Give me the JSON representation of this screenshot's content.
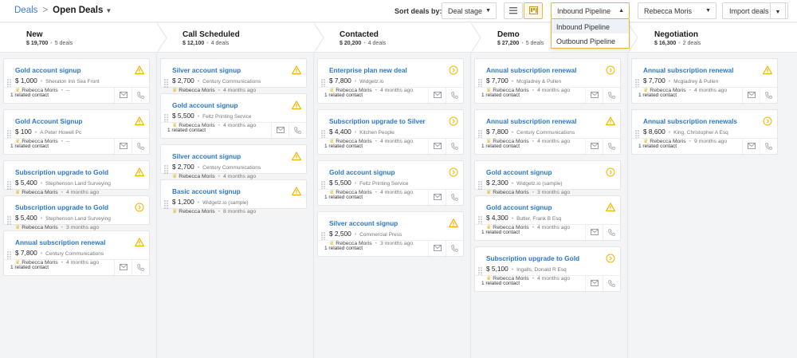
{
  "breadcrumb": {
    "root": "Deals",
    "separator": ">",
    "current": "Open Deals"
  },
  "toolbar": {
    "sort_label": "Sort deals by:",
    "sort_value": "Deal stage",
    "pipeline_value": "Inbound Pipeline",
    "pipeline_options": [
      "Inbound Pipeline",
      "Outbound Pipeline"
    ],
    "owner_value": "Rebecca Moris",
    "import_label": "Import deals"
  },
  "stages": [
    {
      "name": "New",
      "amount": "$ 19,700",
      "count": "5 deals"
    },
    {
      "name": "Call Scheduled",
      "amount": "$ 12,100",
      "count": "4 deals"
    },
    {
      "name": "Contacted",
      "amount": "$ 20,200",
      "count": "4 deals"
    },
    {
      "name": "Demo",
      "amount": "$ 27,200",
      "count": "5 deals"
    },
    {
      "name": "Negotiation",
      "amount": "$ 16,300",
      "count": "2 deals"
    }
  ],
  "related_label": "1 related contact",
  "columns": [
    {
      "cards": [
        {
          "title": "Gold account signup",
          "value": "$ 1,000",
          "org": "Sheraton Inn Sea Front",
          "owner": "Rebecca Moris",
          "ago": "--",
          "status": "warn",
          "footer": true
        },
        {
          "title": "Gold Account Signup",
          "value": "$ 100",
          "org": "A Peter Howell Pc",
          "owner": "Rebecca Moris",
          "ago": "--",
          "status": "warn",
          "footer": true
        },
        {
          "title": "Subscription upgrade to Gold",
          "value": "$ 5,400",
          "org": "Stephenson Land Surveying",
          "owner": "Rebecca Moris",
          "ago": "4 months ago",
          "status": "warn",
          "footer": false
        },
        {
          "title": "Subscription upgrade to Gold",
          "value": "$ 5,400",
          "org": "Stephenson Land Surveying",
          "owner": "Rebecca Moris",
          "ago": "3 months ago",
          "status": "next",
          "footer": false
        },
        {
          "title": "Annual subscription renewal",
          "value": "$ 7,800",
          "org": "Century Communications",
          "owner": "Rebecca Moris",
          "ago": "4 months ago",
          "status": "warn",
          "footer": true
        }
      ]
    },
    {
      "cards": [
        {
          "title": "Silver account signup",
          "value": "$ 2,700",
          "org": "Century Communications",
          "owner": "Rebecca Moris",
          "ago": "4 months ago",
          "status": "warn",
          "footer": false
        },
        {
          "title": "Gold account signup",
          "value": "$ 5,500",
          "org": "Feltz Printing Service",
          "owner": "Rebecca Moris",
          "ago": "4 months ago",
          "status": "warn",
          "footer": true
        },
        {
          "title": "Silver account signup",
          "value": "$ 2,700",
          "org": "Century Communications",
          "owner": "Rebecca Moris",
          "ago": "4 months ago",
          "status": "warn",
          "footer": false
        },
        {
          "title": "Basic account signup",
          "value": "$ 1,200",
          "org": "Widgetz.io (sample)",
          "owner": "Rebecca Moris",
          "ago": "8 months ago",
          "status": "warn",
          "footer": false
        }
      ]
    },
    {
      "cards": [
        {
          "title": "Enterprise plan new deal",
          "value": "$ 7,800",
          "org": "Widgetz.io",
          "owner": "Rebecca Moris",
          "ago": "4 months ago",
          "status": "next",
          "footer": true
        },
        {
          "title": "Subscription upgrade to Silver",
          "value": "$ 4,400",
          "org": "Kitchen People",
          "owner": "Rebecca Moris",
          "ago": "4 months ago",
          "status": "next",
          "footer": true
        },
        {
          "title": "Gold account signup",
          "value": "$ 5,500",
          "org": "Feltz Printing Service",
          "owner": "Rebecca Moris",
          "ago": "4 months ago",
          "status": "next",
          "footer": true
        },
        {
          "title": "Silver account signup",
          "value": "$ 2,500",
          "org": "Commercial Press",
          "owner": "Rebecca Moris",
          "ago": "3 months ago",
          "status": "warn",
          "footer": true
        }
      ]
    },
    {
      "cards": [
        {
          "title": "Annual subscription renewal",
          "value": "$ 7,700",
          "org": "Mcgladrey & Pullen",
          "owner": "Rebecca Moris",
          "ago": "4 months ago",
          "status": "next",
          "footer": true
        },
        {
          "title": "Annual subscription renewal",
          "value": "$ 7,800",
          "org": "Century Communications",
          "owner": "Rebecca Moris",
          "ago": "4 months ago",
          "status": "warn",
          "footer": true
        },
        {
          "title": "Gold account signup",
          "value": "$ 2,300",
          "org": "Widgetz.io (sample)",
          "owner": "Rebecca Moris",
          "ago": "3 months ago",
          "status": "next",
          "footer": false
        },
        {
          "title": "Gold account signup",
          "value": "$ 4,300",
          "org": "Butler, Frank B Esq",
          "owner": "Rebecca Moris",
          "ago": "4 months ago",
          "status": "warn",
          "footer": true
        },
        {
          "title": "Subscription upgrade to Gold",
          "value": "$ 5,100",
          "org": "Ingalls, Donald R Esq",
          "owner": "Rebecca Moris",
          "ago": "4 months ago",
          "status": "next",
          "footer": true
        }
      ]
    },
    {
      "cards": [
        {
          "title": "Annual subscription renewal",
          "value": "$ 7,700",
          "org": "Mcgladrey & Pullen",
          "owner": "Rebecca Moris",
          "ago": "4 months ago",
          "status": "warn",
          "footer": true
        },
        {
          "title": "Annual subscription renewals",
          "value": "$ 8,600",
          "org": "King, Christopher A Esq",
          "owner": "Rebecca Moris",
          "ago": "9 months ago",
          "status": "next",
          "footer": true
        }
      ]
    }
  ],
  "colors": {
    "link": "#2b77c9",
    "warn": "#f0b400",
    "accent": "#e8b93a"
  }
}
